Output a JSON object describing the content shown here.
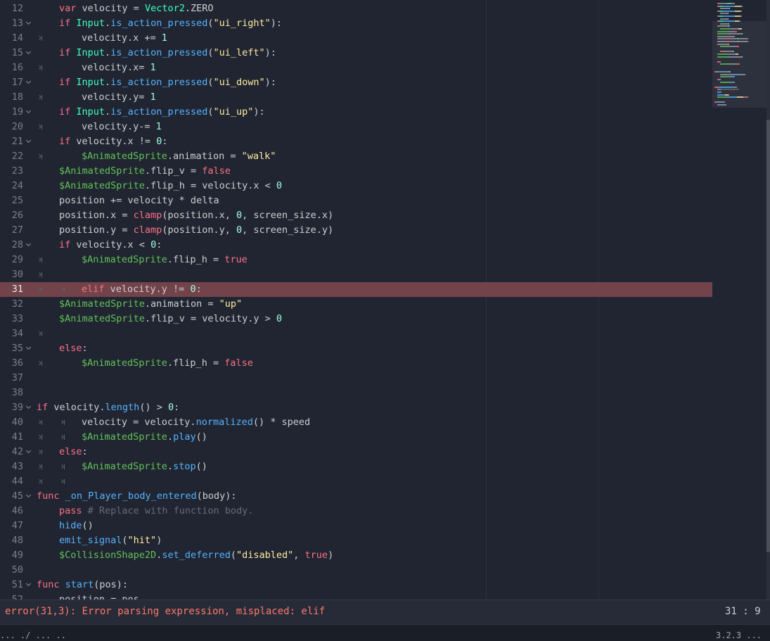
{
  "editor": {
    "lines": [
      {
        "n": "12",
        "fold": false,
        "err": false,
        "t": [
          {
            "t": "\t"
          },
          {
            "c": "kw",
            "v": "var"
          },
          {
            "v": " velocity = "
          },
          {
            "c": "ty",
            "v": "Vector2"
          },
          {
            "v": ".ZERO"
          }
        ]
      },
      {
        "n": "13",
        "fold": true,
        "err": false,
        "t": [
          {
            "t": "\t"
          },
          {
            "c": "kw",
            "v": "if"
          },
          {
            "v": " "
          },
          {
            "c": "ty",
            "v": "Input"
          },
          {
            "v": "."
          },
          {
            "c": "fn",
            "v": "is_action_pressed"
          },
          {
            "v": "("
          },
          {
            "c": "st",
            "v": "\"ui_right\""
          },
          {
            "v": "):"
          }
        ]
      },
      {
        "n": "14",
        "fold": false,
        "err": false,
        "t": [
          {
            "t": ">"
          },
          {
            "t": "\t"
          },
          {
            "v": "velocity.x += "
          },
          {
            "c": "nu",
            "v": "1"
          }
        ]
      },
      {
        "n": "15",
        "fold": true,
        "err": false,
        "t": [
          {
            "t": "\t"
          },
          {
            "c": "kw",
            "v": "if"
          },
          {
            "v": " "
          },
          {
            "c": "ty",
            "v": "Input"
          },
          {
            "v": "."
          },
          {
            "c": "fn",
            "v": "is_action_pressed"
          },
          {
            "v": "("
          },
          {
            "c": "st",
            "v": "\"ui_left\""
          },
          {
            "v": "):"
          }
        ]
      },
      {
        "n": "16",
        "fold": false,
        "err": false,
        "t": [
          {
            "t": ">"
          },
          {
            "t": "\t"
          },
          {
            "v": "velocity.x= "
          },
          {
            "c": "nu",
            "v": "1"
          }
        ]
      },
      {
        "n": "17",
        "fold": true,
        "err": false,
        "t": [
          {
            "t": "\t"
          },
          {
            "c": "kw",
            "v": "if"
          },
          {
            "v": " "
          },
          {
            "c": "ty",
            "v": "Input"
          },
          {
            "v": "."
          },
          {
            "c": "fn",
            "v": "is_action_pressed"
          },
          {
            "v": "("
          },
          {
            "c": "st",
            "v": "\"ui_down\""
          },
          {
            "v": "):"
          }
        ]
      },
      {
        "n": "18",
        "fold": false,
        "err": false,
        "t": [
          {
            "t": ">"
          },
          {
            "t": "\t"
          },
          {
            "v": "velocity.y= "
          },
          {
            "c": "nu",
            "v": "1"
          }
        ]
      },
      {
        "n": "19",
        "fold": true,
        "err": false,
        "t": [
          {
            "t": "\t"
          },
          {
            "c": "kw",
            "v": "if"
          },
          {
            "v": " "
          },
          {
            "c": "ty",
            "v": "Input"
          },
          {
            "v": "."
          },
          {
            "c": "fn",
            "v": "is_action_pressed"
          },
          {
            "v": "("
          },
          {
            "c": "st",
            "v": "\"ui_up\""
          },
          {
            "v": "):"
          }
        ]
      },
      {
        "n": "20",
        "fold": false,
        "err": false,
        "t": [
          {
            "t": ">"
          },
          {
            "t": "\t"
          },
          {
            "v": "velocity.y-= "
          },
          {
            "c": "nu",
            "v": "1"
          }
        ]
      },
      {
        "n": "21",
        "fold": true,
        "err": false,
        "t": [
          {
            "t": "\t"
          },
          {
            "c": "kw",
            "v": "if"
          },
          {
            "v": " velocity.x != "
          },
          {
            "c": "nu",
            "v": "0"
          },
          {
            "v": ":"
          }
        ]
      },
      {
        "n": "22",
        "fold": false,
        "err": false,
        "t": [
          {
            "t": ">"
          },
          {
            "t": "\t"
          },
          {
            "c": "nd",
            "v": "$AnimatedSprite"
          },
          {
            "v": ".animation = "
          },
          {
            "c": "st",
            "v": "\"walk\""
          }
        ]
      },
      {
        "n": "23",
        "fold": false,
        "err": false,
        "t": [
          {
            "t": "\t"
          },
          {
            "c": "nd",
            "v": "$AnimatedSprite"
          },
          {
            "v": ".flip_v = "
          },
          {
            "c": "bi",
            "v": "false"
          }
        ]
      },
      {
        "n": "24",
        "fold": false,
        "err": false,
        "t": [
          {
            "t": "\t"
          },
          {
            "c": "nd",
            "v": "$AnimatedSprite"
          },
          {
            "v": ".flip_h = velocity.x < "
          },
          {
            "c": "nu",
            "v": "0"
          }
        ]
      },
      {
        "n": "25",
        "fold": false,
        "err": false,
        "t": [
          {
            "t": "\t"
          },
          {
            "v": "position += velocity * delta"
          }
        ]
      },
      {
        "n": "26",
        "fold": false,
        "err": false,
        "t": [
          {
            "t": "\t"
          },
          {
            "v": "position.x = "
          },
          {
            "c": "kw",
            "v": "clamp"
          },
          {
            "v": "(position.x, "
          },
          {
            "c": "nu",
            "v": "0"
          },
          {
            "v": ", screen_size.x)"
          }
        ]
      },
      {
        "n": "27",
        "fold": false,
        "err": false,
        "t": [
          {
            "t": "\t"
          },
          {
            "v": "position.y = "
          },
          {
            "c": "kw",
            "v": "clamp"
          },
          {
            "v": "(position.y, "
          },
          {
            "c": "nu",
            "v": "0"
          },
          {
            "v": ", screen_size.y)"
          }
        ]
      },
      {
        "n": "28",
        "fold": true,
        "err": false,
        "t": [
          {
            "t": "\t"
          },
          {
            "c": "kw",
            "v": "if"
          },
          {
            "v": " velocity.x < "
          },
          {
            "c": "nu",
            "v": "0"
          },
          {
            "v": ":"
          }
        ]
      },
      {
        "n": "29",
        "fold": false,
        "err": false,
        "t": [
          {
            "t": ">"
          },
          {
            "t": "\t"
          },
          {
            "c": "nd",
            "v": "$AnimatedSprite"
          },
          {
            "v": ".flip_h = "
          },
          {
            "c": "bi",
            "v": "true"
          }
        ]
      },
      {
        "n": "30",
        "fold": false,
        "err": false,
        "t": [
          {
            "t": ">"
          }
        ]
      },
      {
        "n": "31",
        "fold": false,
        "err": true,
        "t": [
          {
            "t": ">"
          },
          {
            "t": ">"
          },
          {
            "c": "kw",
            "v": "elif"
          },
          {
            "v": " velocity.y != "
          },
          {
            "c": "nu",
            "v": "0"
          },
          {
            "v": ":"
          }
        ]
      },
      {
        "n": "32",
        "fold": false,
        "err": false,
        "t": [
          {
            "t": "\t"
          },
          {
            "c": "nd",
            "v": "$AnimatedSprite"
          },
          {
            "v": ".animation = "
          },
          {
            "c": "st",
            "v": "\"up\""
          }
        ]
      },
      {
        "n": "33",
        "fold": false,
        "err": false,
        "t": [
          {
            "t": "\t"
          },
          {
            "c": "nd",
            "v": "$AnimatedSprite"
          },
          {
            "v": ".flip_v = velocity.y > "
          },
          {
            "c": "nu",
            "v": "0"
          }
        ]
      },
      {
        "n": "34",
        "fold": false,
        "err": false,
        "t": [
          {
            "t": ">"
          }
        ]
      },
      {
        "n": "35",
        "fold": true,
        "err": false,
        "t": [
          {
            "t": "\t"
          },
          {
            "c": "kw",
            "v": "else"
          },
          {
            "v": ":"
          }
        ]
      },
      {
        "n": "36",
        "fold": false,
        "err": false,
        "t": [
          {
            "t": ">"
          },
          {
            "t": "\t"
          },
          {
            "c": "nd",
            "v": "$AnimatedSprite"
          },
          {
            "v": ".flip_h = "
          },
          {
            "c": "bi",
            "v": "false"
          }
        ]
      },
      {
        "n": "37",
        "fold": false,
        "err": false,
        "t": []
      },
      {
        "n": "38",
        "fold": false,
        "err": false,
        "t": []
      },
      {
        "n": "39",
        "fold": true,
        "err": false,
        "t": [
          {
            "c": "kw",
            "v": "if"
          },
          {
            "v": " velocity."
          },
          {
            "c": "fn",
            "v": "length"
          },
          {
            "v": "() > "
          },
          {
            "c": "nu",
            "v": "0"
          },
          {
            "v": ":"
          }
        ]
      },
      {
        "n": "40",
        "fold": false,
        "err": false,
        "t": [
          {
            "t": ">"
          },
          {
            "t": ">"
          },
          {
            "v": "velocity = velocity."
          },
          {
            "c": "fn",
            "v": "normalized"
          },
          {
            "v": "() * speed"
          }
        ]
      },
      {
        "n": "41",
        "fold": false,
        "err": false,
        "t": [
          {
            "t": ">"
          },
          {
            "t": ">"
          },
          {
            "c": "nd",
            "v": "$AnimatedSprite"
          },
          {
            "v": "."
          },
          {
            "c": "fn",
            "v": "play"
          },
          {
            "v": "()"
          }
        ]
      },
      {
        "n": "42",
        "fold": true,
        "err": false,
        "t": [
          {
            "t": ">"
          },
          {
            "c": "kw",
            "v": "else"
          },
          {
            "v": ":"
          }
        ]
      },
      {
        "n": "43",
        "fold": false,
        "err": false,
        "t": [
          {
            "t": ">"
          },
          {
            "t": ">"
          },
          {
            "c": "nd",
            "v": "$AnimatedSprite"
          },
          {
            "v": "."
          },
          {
            "c": "fn",
            "v": "stop"
          },
          {
            "v": "()"
          }
        ]
      },
      {
        "n": "44",
        "fold": false,
        "err": false,
        "t": [
          {
            "t": ">"
          },
          {
            "t": ">"
          }
        ]
      },
      {
        "n": "45",
        "fold": true,
        "err": false,
        "t": [
          {
            "c": "kw",
            "v": "func"
          },
          {
            "v": " "
          },
          {
            "c": "fn",
            "v": "_on_Player_body_entered"
          },
          {
            "v": "(body):"
          }
        ]
      },
      {
        "n": "46",
        "fold": false,
        "err": false,
        "t": [
          {
            "t": "\t"
          },
          {
            "c": "kw",
            "v": "pass"
          },
          {
            "v": " "
          },
          {
            "c": "cm",
            "v": "# Replace with function body."
          }
        ]
      },
      {
        "n": "47",
        "fold": false,
        "err": false,
        "t": [
          {
            "t": "\t"
          },
          {
            "c": "fn",
            "v": "hide"
          },
          {
            "v": "()"
          }
        ]
      },
      {
        "n": "48",
        "fold": false,
        "err": false,
        "t": [
          {
            "t": "\t"
          },
          {
            "c": "fn",
            "v": "emit_signal"
          },
          {
            "v": "("
          },
          {
            "c": "st",
            "v": "\"hit\""
          },
          {
            "v": ")"
          }
        ]
      },
      {
        "n": "49",
        "fold": false,
        "err": false,
        "t": [
          {
            "t": "\t"
          },
          {
            "c": "nd",
            "v": "$CollisionShape2D"
          },
          {
            "v": "."
          },
          {
            "c": "fn",
            "v": "set_deferred"
          },
          {
            "v": "("
          },
          {
            "c": "st",
            "v": "\"disabled\""
          },
          {
            "v": ", "
          },
          {
            "c": "bi",
            "v": "true"
          },
          {
            "v": ")"
          }
        ]
      },
      {
        "n": "50",
        "fold": false,
        "err": false,
        "t": []
      },
      {
        "n": "51",
        "fold": true,
        "err": false,
        "t": [
          {
            "c": "kw",
            "v": "func"
          },
          {
            "v": " "
          },
          {
            "c": "fn",
            "v": "start"
          },
          {
            "v": "(pos):"
          }
        ]
      },
      {
        "n": "52",
        "fold": false,
        "err": false,
        "t": [
          {
            "t": "\t"
          },
          {
            "v": "position = pos"
          }
        ]
      }
    ]
  },
  "status": {
    "error": "error(31,3): Error parsing expression, misplaced: elif",
    "cursor": "31 :   9"
  },
  "bottom": {
    "left": "... ./ ... ..",
    "right": "3.2.3 ..."
  },
  "colors": {
    "background": "#202531",
    "error_line": "#72434a",
    "error_text": "#ff786b",
    "keyword": "#ff7085",
    "type": "#42ffc2",
    "function": "#57b3ff",
    "string": "#ffeda1",
    "number": "#a1ffe0",
    "node_path": "#63c259",
    "comment": "#676b74"
  }
}
